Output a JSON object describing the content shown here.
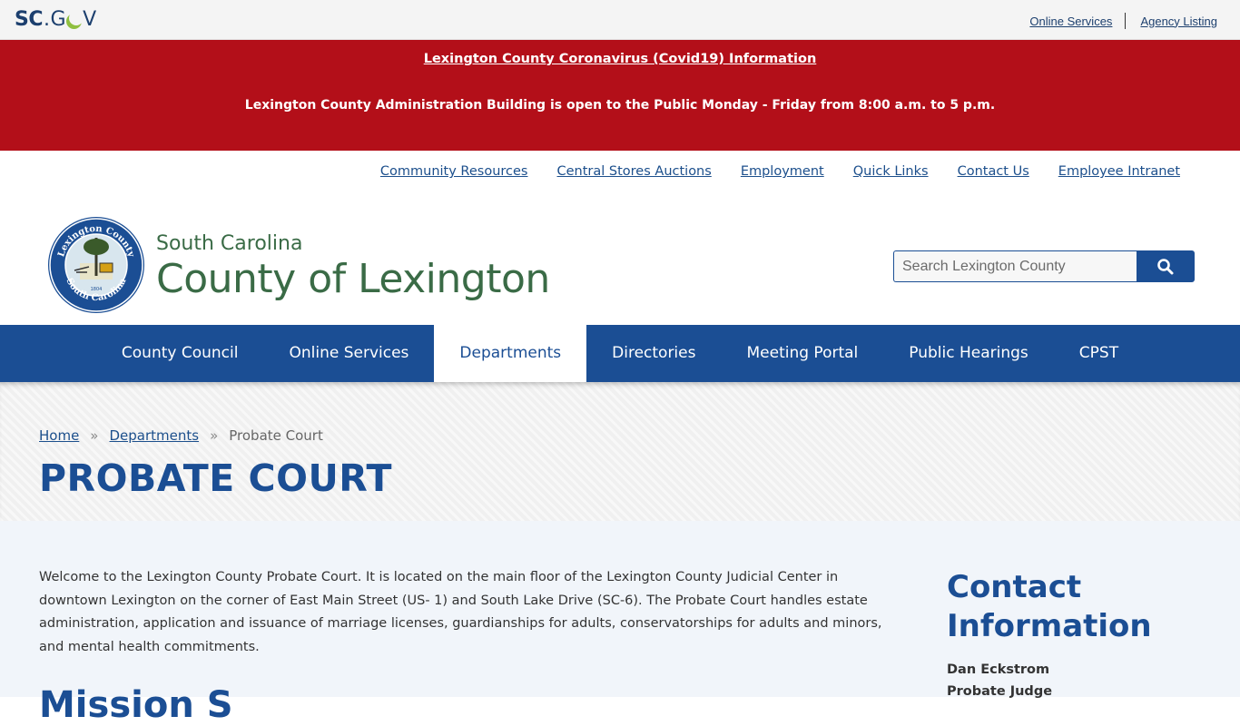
{
  "scgov": {
    "logo_sc": "SC",
    "logo_dot": ".",
    "logo_g": "G",
    "logo_v": "V",
    "links": [
      "Online Services",
      "Agency Listing"
    ]
  },
  "alert": {
    "headline": "Lexington County Coronavirus (Covid19) Information",
    "notice": "Lexington County Administration Building is open to the Public Monday - Friday from 8:00 a.m. to 5 p.m."
  },
  "utility_nav": [
    "Community Resources",
    "Central Stores Auctions",
    "Employment",
    "Quick Links",
    "Contact Us",
    "Employee Intranet"
  ],
  "header": {
    "state": "South Carolina",
    "county": "County of Lexington",
    "seal_top_text": "Lexington County",
    "seal_bottom_text": "South Carolina",
    "seal_year": "1804"
  },
  "search": {
    "placeholder": "Search Lexington County",
    "icon": "search-icon"
  },
  "main_nav": {
    "items": [
      "County Council",
      "Online Services",
      "Departments",
      "Directories",
      "Meeting Portal",
      "Public Hearings",
      "CPST"
    ],
    "active": "Departments"
  },
  "breadcrumb": {
    "home": "Home",
    "separator": "»",
    "section": "Departments",
    "current": "Probate Court"
  },
  "page": {
    "title": "PROBATE COURT",
    "intro": "Welcome to the Lexington County Probate Court. It is located on the main floor of the Lexington County Judicial Center in downtown Lexington on the corner of East Main Street (US- 1) and South Lake Drive (SC-6).  The Probate Court handles estate administration, application and issuance of marriage licenses, guardianships for adults, conservatorships for adults and minors, and mental health commitments.",
    "mission_heading": "Mission S"
  },
  "contact": {
    "title": "Contact Information",
    "name": "Dan Eckstrom",
    "role": "Probate Judge"
  },
  "colors": {
    "brand_blue": "#1b4e94",
    "alert_red": "#b30f19",
    "brand_green": "#3a6b46"
  }
}
